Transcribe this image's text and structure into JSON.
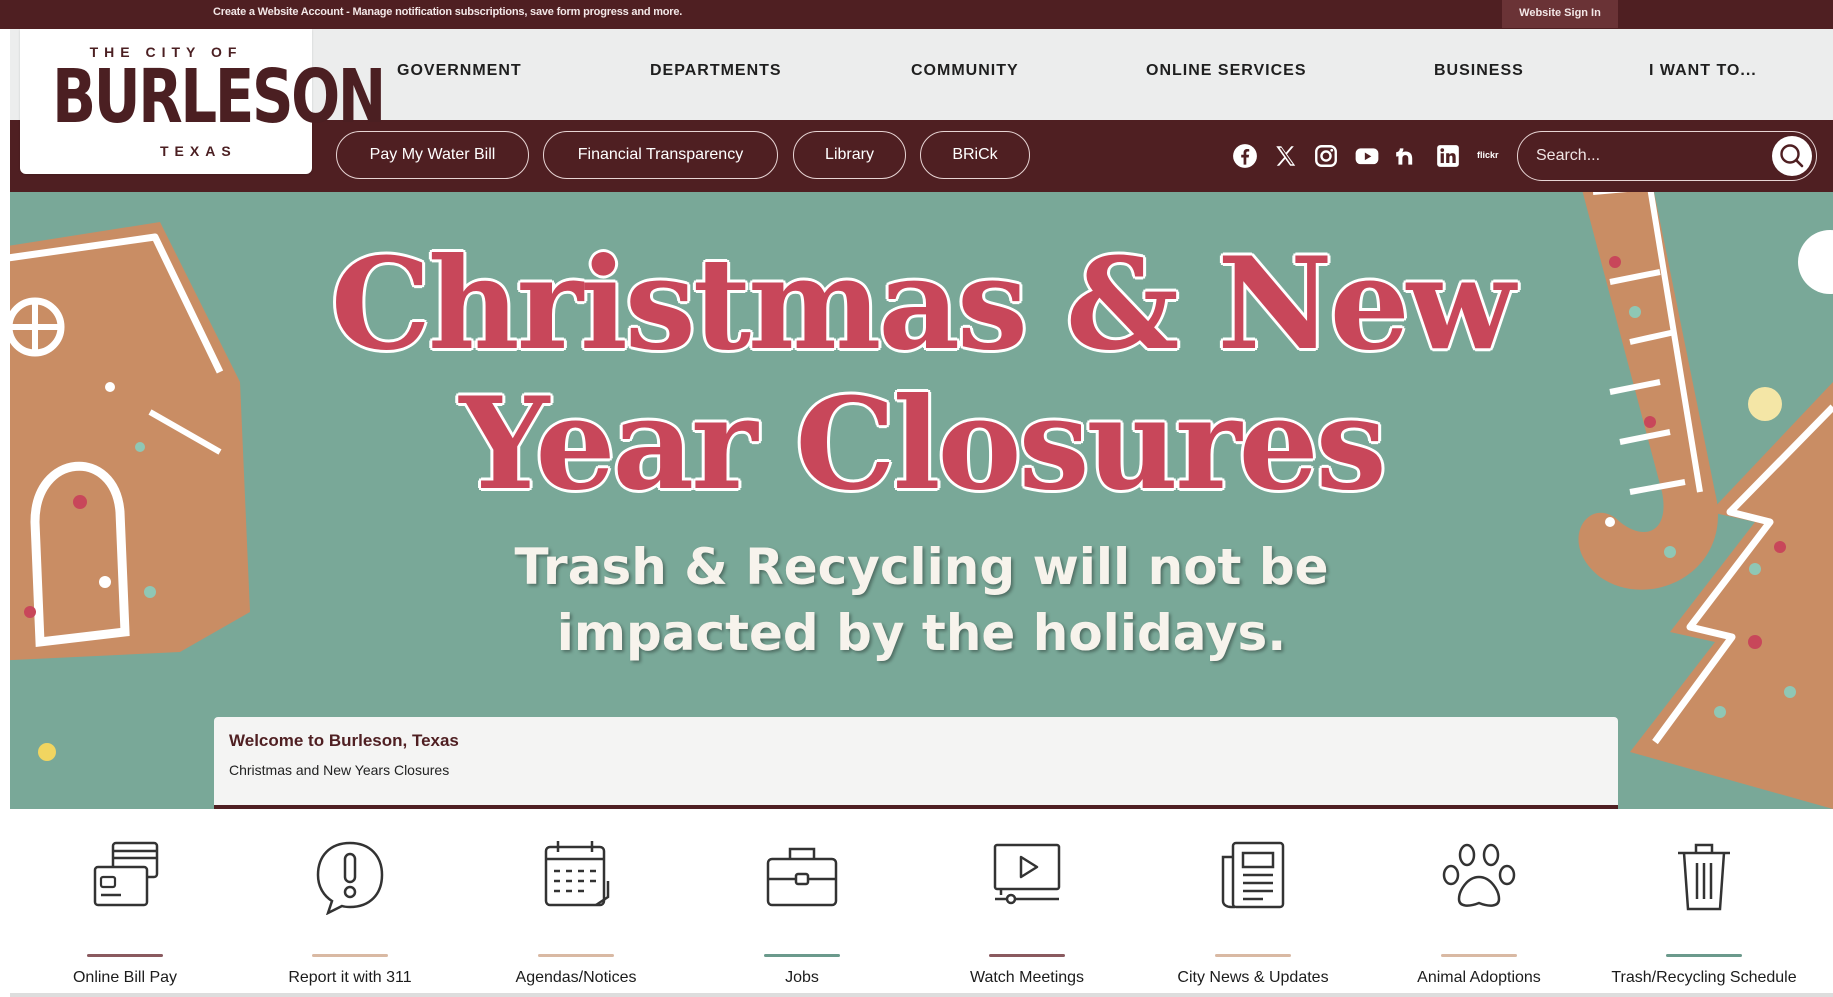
{
  "top_strip": {
    "account_text": "Create a Website Account - Manage notification subscriptions, save form progress and more.",
    "sign_in": "Website Sign In"
  },
  "logo": {
    "city_of": "THE CITY OF",
    "name": "BURLESON",
    "state": "TEXAS"
  },
  "nav": [
    "GOVERNMENT",
    "DEPARTMENTS",
    "COMMUNITY",
    "ONLINE SERVICES",
    "BUSINESS",
    "I WANT TO..."
  ],
  "pills": [
    "Pay My Water Bill",
    "Financial Transparency",
    "Library",
    "BRiCk"
  ],
  "social": [
    "facebook-icon",
    "x-icon",
    "instagram-icon",
    "youtube-icon",
    "nextdoor-icon",
    "linkedin-icon",
    "flickr-icon"
  ],
  "social_flickr_text": "flickr",
  "search": {
    "placeholder": "Search..."
  },
  "hero": {
    "line1": "Christmas & New",
    "line2": "Year Closures",
    "sub1": "Trash & Recycling will not be",
    "sub2": "impacted by the holidays."
  },
  "welcome": {
    "title": "Welcome to Burleson, Texas",
    "subtitle": "Christmas and New Years Closures"
  },
  "quick_links": [
    {
      "label": "Online Bill Pay",
      "icon": "credit-card-icon",
      "accent": "#8a5a5f"
    },
    {
      "label": "Report it with 311",
      "icon": "alert-bubble-icon",
      "accent": "#d9b9a3"
    },
    {
      "label": "Agendas/Notices",
      "icon": "calendar-icon",
      "accent": "#d9b9a3"
    },
    {
      "label": "Jobs",
      "icon": "briefcase-icon",
      "accent": "#6b9a8c"
    },
    {
      "label": "Watch Meetings",
      "icon": "video-player-icon",
      "accent": "#8a5a5f"
    },
    {
      "label": "City News & Updates",
      "icon": "newspaper-icon",
      "accent": "#d9b9a3"
    },
    {
      "label": "Animal Adoptions",
      "icon": "paw-icon",
      "accent": "#d9b9a3"
    },
    {
      "label": "Trash/Recycling Schedule",
      "icon": "trash-can-icon",
      "accent": "#6b9a8c"
    }
  ],
  "colors": {
    "brand_maroon": "#4f1f22",
    "hero_green": "#79a898",
    "headline_red": "#c8475a"
  }
}
